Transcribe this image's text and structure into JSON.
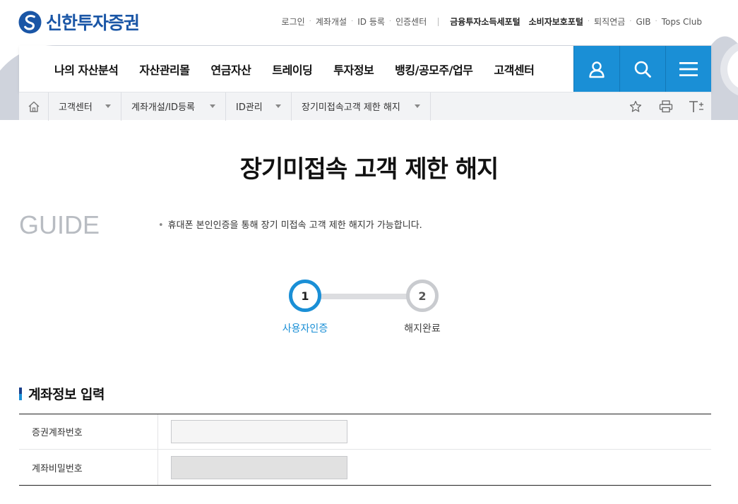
{
  "brand": {
    "name": "신한투자증권",
    "brand_color": "#1a56a6",
    "accent_color": "#1a8fd6"
  },
  "util_nav": {
    "left": [
      "로그인",
      "계좌개설",
      "ID 등록",
      "인증센터"
    ],
    "right_strong": [
      "금융투자소득세포털",
      "소비자보호포털"
    ],
    "right": [
      "퇴직연금",
      "GIB",
      "Tops Club"
    ]
  },
  "gnb": {
    "menu": [
      "나의 자산분석",
      "자산관리몰",
      "연금자산",
      "트레이딩",
      "투자정보",
      "뱅킹/공모주/업무",
      "고객센터"
    ],
    "buttons": [
      "user-icon",
      "search-icon",
      "menu-icon"
    ]
  },
  "breadcrumb": {
    "items": [
      "고객센터",
      "계좌개설/ID등록",
      "ID관리",
      "장기미접속고객 제한 해지"
    ],
    "tools": [
      "star-icon",
      "print-icon",
      "text-size-icon"
    ]
  },
  "page": {
    "title": "장기미접속 고객 제한 해지",
    "guide_label": "GUIDE",
    "guide_text": "휴대폰 본인인증을 통해 장기 미접속 고객 제한 해지가 가능합니다."
  },
  "steps": [
    {
      "number": "1",
      "label": "사용자인증",
      "active": true
    },
    {
      "number": "2",
      "label": "해지완료",
      "active": false
    }
  ],
  "account_section": {
    "title": "계좌정보 입력",
    "rows": [
      {
        "label": "증권계좌번호",
        "value": ""
      },
      {
        "label": "계좌비밀번호",
        "value": ""
      }
    ]
  }
}
